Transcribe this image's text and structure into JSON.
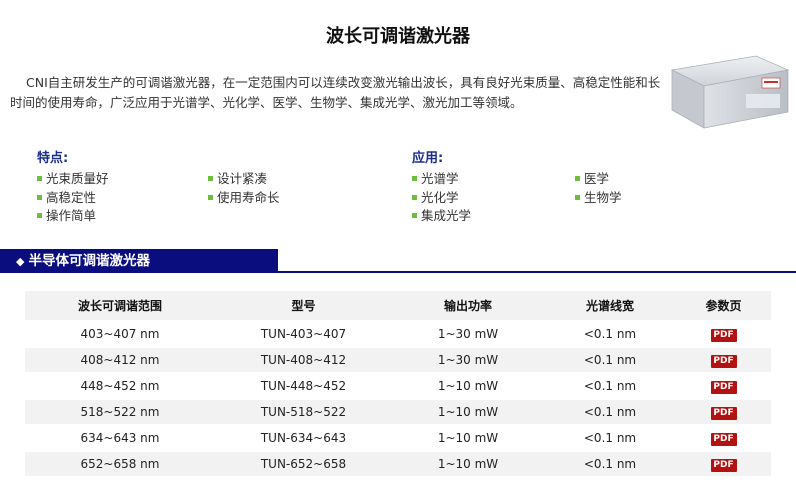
{
  "page": {
    "title": "波长可调谐激光器",
    "intro": "CNI自主研发生产的可调谐激光器，在一定范围内可以连续改变激光输出波长，具有良好光束质量、高稳定性能和长时间的使用寿命，广泛应用于光谱学、光化学、医学、生物学、集成光学、激光加工等领域。"
  },
  "features": {
    "heading": "特点:",
    "col1": [
      "光束质量好",
      "高稳定性",
      "操作简单"
    ],
    "col2": [
      "设计紧凑",
      "使用寿命长"
    ]
  },
  "applications": {
    "heading": "应用:",
    "col1": [
      "光谱学",
      "光化学",
      "集成光学"
    ],
    "col2": [
      "医学",
      "生物学"
    ]
  },
  "section": {
    "banner": "半导体可调谐激光器",
    "diamond": "◆"
  },
  "colors": {
    "banner": "#0a0d7e",
    "heading": "#1a2f8a",
    "bullet": "#6cbf3c",
    "pdf": "#b31212"
  },
  "chart_data": {
    "type": "table",
    "columns": [
      "波长可调谐范围",
      "型号",
      "输出功率",
      "光谱线宽",
      "参数页"
    ],
    "rows": [
      [
        "403~407 nm",
        "TUN-403~407",
        "1~30 mW",
        "<0.1 nm",
        "PDF"
      ],
      [
        "408~412 nm",
        "TUN-408~412",
        "1~30 mW",
        "<0.1 nm",
        "PDF"
      ],
      [
        "448~452 nm",
        "TUN-448~452",
        "1~10 mW",
        "<0.1 nm",
        "PDF"
      ],
      [
        "518~522 nm",
        "TUN-518~522",
        "1~10 mW",
        "<0.1 nm",
        "PDF"
      ],
      [
        "634~643 nm",
        "TUN-634~643",
        "1~10 mW",
        "<0.1 nm",
        "PDF"
      ],
      [
        "652~658 nm",
        "TUN-652~658",
        "1~10 mW",
        "<0.1 nm",
        "PDF"
      ]
    ]
  }
}
